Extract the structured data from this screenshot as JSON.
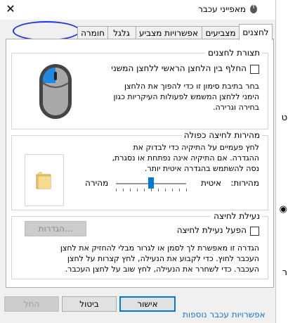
{
  "window": {
    "title": "מאפייני עכבר",
    "close_glyph": "✕"
  },
  "tabs": [
    "לחצנים",
    "מצביעים",
    "אפשרויות מצביע",
    "גלגל",
    "חומרה"
  ],
  "buttons_config": {
    "title": "תצורת לחצנים",
    "checkbox_label": "החלף בין הלחצן הראשי ללחצן המשני",
    "checked": false,
    "description": [
      "בחר בתיבת סימון זו כדי להפוך את הלחצן",
      "הימני ללחצן המשמש לפעולות העיקריות כגון",
      "בחירה וגרירה."
    ]
  },
  "double_click": {
    "title": "מהירות לחיצה כפולה",
    "description": [
      "לחץ פעמיים על התיקיה כדי לבדוק את",
      "ההגדרה. אם התיקיה אינה נפתחת או נסגרת,",
      "נסה להשתמש בהגדרה איטית יותר."
    ],
    "speed_label": "מהירות:",
    "slow_label": "איטית",
    "fast_label": "מהירה",
    "speed_value": 0.5
  },
  "click_lock": {
    "title": "נעילת לחיצה",
    "checkbox_label": "הפעל נעילת לחיצה",
    "checked": false,
    "settings_button": "הגדרות...",
    "description": [
      "הגדרה זו מאפשרת לך לסמן או לגרור מבלי להחזיק את לחצן",
      "העכבר לחוץ. כדי לקבוע את הנעילה, לחץ קצרות על לחצן",
      "העכבר. כדי לשחרר את הנעילה, לחץ שוב על לחצן העכבר."
    ]
  },
  "footer": {
    "ok": "אישור",
    "cancel": "ביטול",
    "apply": "החל"
  },
  "background": {
    "bottom_link": "אפשרויות עכבר נוספות"
  },
  "colors": {
    "accent": "#0078d7",
    "annotation": "#1d35e8"
  }
}
